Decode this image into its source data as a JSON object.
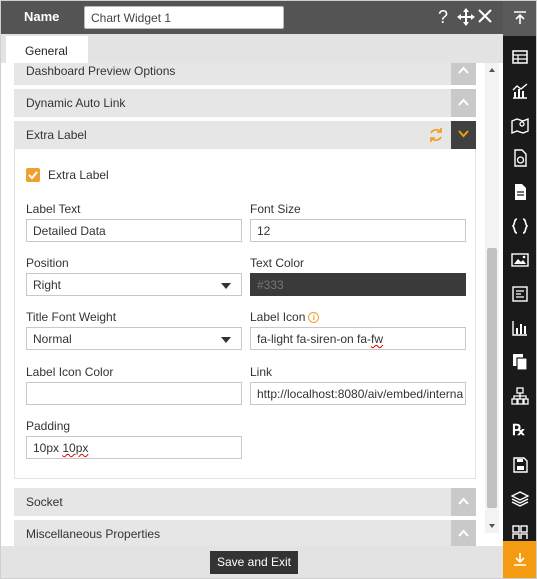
{
  "header": {
    "name_label": "Name",
    "name_value": "Chart Widget 1",
    "icons": [
      "help-icon",
      "move-icon",
      "close-icon"
    ]
  },
  "tabs": [
    {
      "label": "General",
      "active": true
    }
  ],
  "sections": {
    "dashboard_preview": {
      "label": "Dashboard Preview Options"
    },
    "dynamic_auto_link": {
      "label": "Dynamic Auto Link"
    },
    "extra_label": {
      "label": "Extra Label"
    },
    "socket": {
      "label": "Socket"
    },
    "misc": {
      "label": "Miscellaneous Properties"
    }
  },
  "extra_label_form": {
    "checkbox_label": "Extra Label",
    "checkbox_checked": true,
    "label_text": {
      "label": "Label Text",
      "value": "Detailed Data"
    },
    "font_size": {
      "label": "Font Size",
      "value": "12"
    },
    "position": {
      "label": "Position",
      "value": "Right"
    },
    "text_color": {
      "label": "Text Color",
      "value": "#333"
    },
    "title_font_weight": {
      "label": "Title Font Weight",
      "value": "Normal"
    },
    "label_icon": {
      "label": "Label Icon",
      "value": "fa-light fa-siren-on fa-fw",
      "value_main": "fa-light fa-siren-on fa-",
      "value_squiggle": "fw"
    },
    "label_icon_color": {
      "label": "Label Icon Color",
      "value": ""
    },
    "link": {
      "label": "Link",
      "value": "http://localhost:8080/aiv/embed/interna"
    },
    "padding": {
      "label": "Padding",
      "value": "10px 10px",
      "value_main": "10px ",
      "value_squiggle": "10px"
    }
  },
  "footer": {
    "save_label": "Save and Exit"
  },
  "toolbar": {
    "icons": [
      "scroll-top-icon",
      "table-icon",
      "chart-icon",
      "map-icon",
      "file-money-icon",
      "document-icon",
      "code-braces-icon",
      "image-icon",
      "form-icon",
      "stats-icon",
      "copy-icon",
      "network-icon",
      "rx-icon",
      "save-doc-icon",
      "layers-icon",
      "grid-icon",
      "scroll-bottom-icon"
    ],
    "rx_label": "℞"
  },
  "colors": {
    "accent": "#f39c12",
    "header_bg": "#545454",
    "toolbar_bg": "#1a1a1a"
  }
}
